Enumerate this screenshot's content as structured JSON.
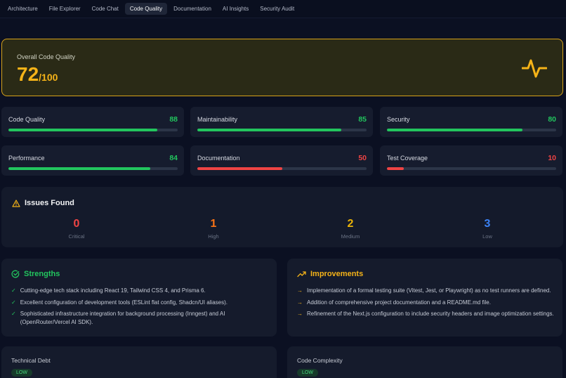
{
  "nav": {
    "tabs": [
      "Architecture",
      "File Explorer",
      "Code Chat",
      "Code Quality",
      "Documentation",
      "AI Insights",
      "Security Audit"
    ],
    "active_tab": "Code Quality"
  },
  "overall": {
    "label": "Overall Code Quality",
    "score": "72",
    "max": "/100",
    "icon": "activity-pulse-icon"
  },
  "metrics": [
    {
      "label": "Code Quality",
      "value": "88",
      "percent": 88,
      "color": "#22c55e"
    },
    {
      "label": "Maintainability",
      "value": "85",
      "percent": 85,
      "color": "#22c55e"
    },
    {
      "label": "Security",
      "value": "80",
      "percent": 80,
      "color": "#22c55e"
    },
    {
      "label": "Performance",
      "value": "84",
      "percent": 84,
      "color": "#22c55e"
    },
    {
      "label": "Documentation",
      "value": "50",
      "percent": 50,
      "color": "#ef4444"
    },
    {
      "label": "Test Coverage",
      "value": "10",
      "percent": 10,
      "color": "#ef4444"
    }
  ],
  "issues": {
    "title": "Issues Found",
    "icon": "warning-triangle-icon",
    "counts": [
      {
        "count": "0",
        "label": "Critical",
        "color": "#ef4444"
      },
      {
        "count": "1",
        "label": "High",
        "color": "#f97316"
      },
      {
        "count": "2",
        "label": "Medium",
        "color": "#eab308"
      },
      {
        "count": "3",
        "label": "Low",
        "color": "#3b82f6"
      }
    ]
  },
  "strengths": {
    "title": "Strengths",
    "icon": "check-circle-icon",
    "color": "#22c55e",
    "items": [
      "Cutting-edge tech stack including React 19, Tailwind CSS 4, and Prisma 6.",
      "Excellent configuration of development tools (ESLint flat config, Shadcn/UI aliases).",
      "Sophisticated infrastructure integration for background processing (Inngest) and AI (OpenRouter/Vercel AI SDK)."
    ]
  },
  "improvements": {
    "title": "Improvements",
    "icon": "trending-up-icon",
    "color": "#f5b318",
    "items": [
      "Implementation of a formal testing suite (Vitest, Jest, or Playwright) as no test runners are defined.",
      "Addition of comprehensive project documentation and a README.md file.",
      "Refinement of the Next.js configuration to include security headers and image optimization settings."
    ]
  },
  "technical_debt": {
    "label": "Technical Debt",
    "badge": "LOW"
  },
  "code_complexity": {
    "label": "Code Complexity",
    "badge": "LOW"
  }
}
